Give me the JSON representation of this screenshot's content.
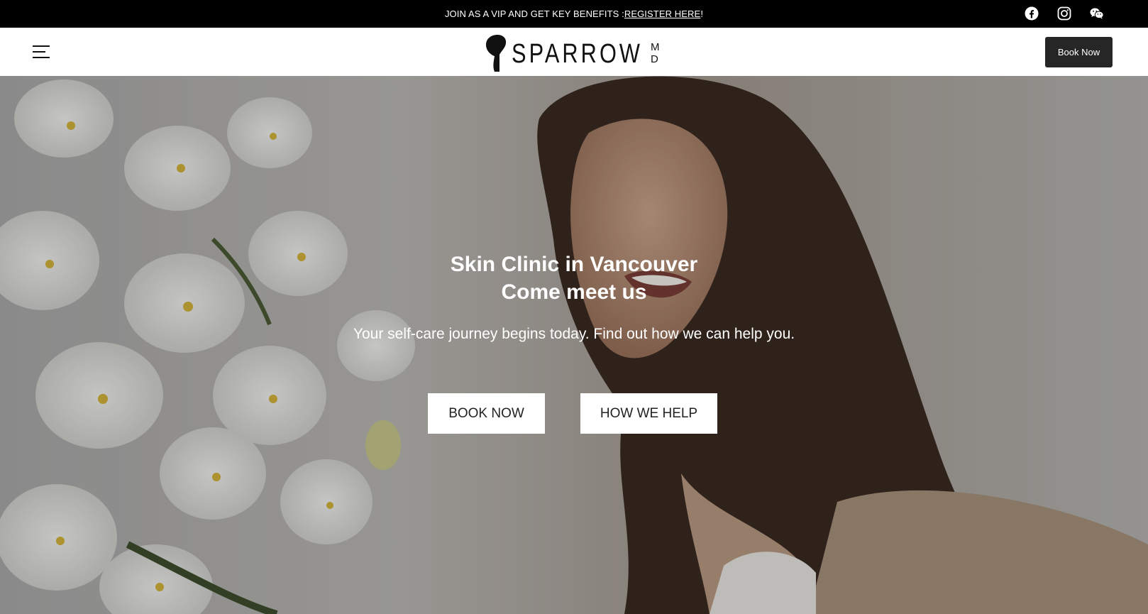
{
  "announcement": {
    "prefix": "JOIN AS A VIP AND GET KEY BENEFITS : ",
    "link": "REGISTER HERE",
    "suffix": "!"
  },
  "social": [
    "facebook-icon",
    "instagram-icon",
    "wechat-icon"
  ],
  "header": {
    "logo_text": "SPARROW",
    "logo_suffix_top": "M",
    "logo_suffix_bottom": "D",
    "book_label": "Book Now"
  },
  "hero": {
    "title_line1": "Skin Clinic in Vancouver",
    "title_line2": "Come meet us",
    "subtitle": "Your self-care journey begins today. Find out how we can help you.",
    "primary_button": "BOOK NOW",
    "secondary_button": "HOW WE HELP"
  },
  "colors": {
    "bar": "#000000",
    "header_bg": "#ffffff",
    "book_button": "#262626"
  }
}
